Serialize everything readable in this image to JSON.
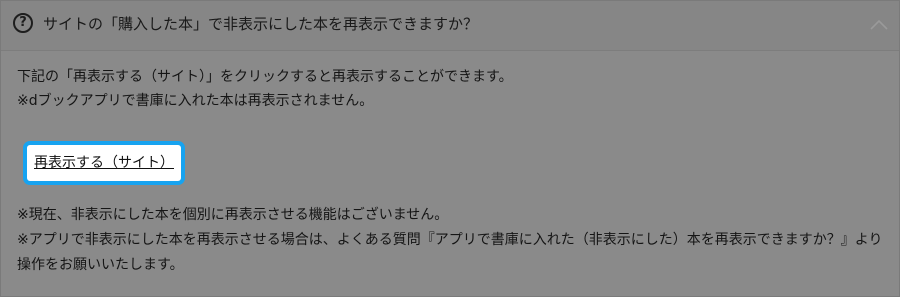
{
  "faq": {
    "icon_glyph": "?",
    "question": "サイトの「購入した本」で非表示にした本を再表示できますか？",
    "expanded": true
  },
  "answer": {
    "line1": "下記の「再表示する（サイト）」をクリックすると再表示することができます。",
    "line2": "※dブックアプリで書庫に入れた本は再表示されません。",
    "link_label": "再表示する（サイト）",
    "note1": "※現在、非表示にした本を個別に再表示させる機能はございません。",
    "note2": "※アプリで非表示にした本を再表示させる場合は、よくある質問『アプリで書庫に入れた（非表示にした）本を再表示できますか？』より操作をお願いいたします。"
  },
  "colors": {
    "overlay_gray": "#8a8a8a",
    "highlight": "#17a3f0",
    "text": "#151515"
  }
}
